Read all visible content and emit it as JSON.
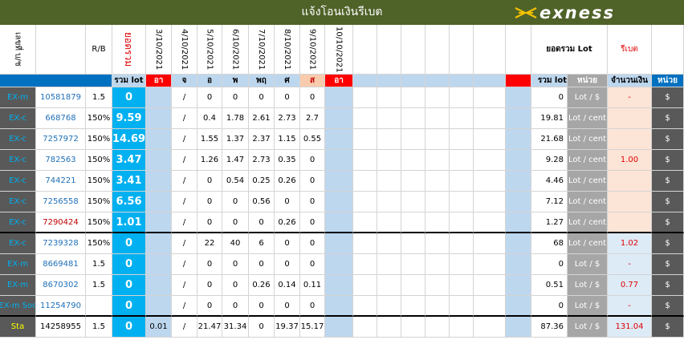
{
  "header": {
    "title": "แจ้งโอนเงินรีเบต",
    "brand": "exness"
  },
  "colors": {
    "title_bar": "#4f6228",
    "label_blue": "#0070c0",
    "cyan": "#00b0f0",
    "light_blue": "#bdd7ee",
    "pale_blue": "#ddebf7",
    "gray": "#a6a6a6",
    "dark_gray": "#595959",
    "red": "#ff0000",
    "peach": "#fce4d6",
    "olive_label": "#ffff00"
  },
  "top_headers": {
    "account": "เลขที่ บ/ช",
    "rb": "R/B",
    "total_rebate": "ยอดรวม",
    "dates": [
      "3/10/2021",
      "4/10/2021",
      "5/10/2021",
      "6/10/2021",
      "7/10/2021",
      "8/10/2021",
      "9/10/2021",
      "10/10/2021"
    ],
    "sum_lot": "ยอดรวม Lot",
    "rebate": "รีเบต"
  },
  "sub_headers": {
    "sum_lot": "รวม lot",
    "days": [
      "อา",
      "จ",
      "อ",
      "พ",
      "พฤ",
      "ศ",
      "ส",
      "อา"
    ],
    "sum_lot2": "รวม lot",
    "unit": "หน่วย",
    "amount": "จำนวนเงิน",
    "unit2": "หน่วย"
  },
  "rows": [
    {
      "type": "EX-m",
      "acc": "10581879",
      "rb": "1.5",
      "total": "0",
      "d": [
        "",
        "/",
        "0",
        "0",
        "0",
        "0",
        "0",
        ""
      ],
      "sum": "0",
      "unit": "Lot / $",
      "amount": "-",
      "cur": "$",
      "acc_color": "blue"
    },
    {
      "type": "EX-c",
      "acc": "668768",
      "rb": "150%",
      "total": "9.59",
      "d": [
        "",
        "/",
        "0.4",
        "1.78",
        "2.61",
        "2.73",
        "2.7",
        ""
      ],
      "sum": "19.81",
      "unit": "Lot / cent",
      "amount": "",
      "cur": "$",
      "acc_color": "blue"
    },
    {
      "type": "EX-c",
      "acc": "7257972",
      "rb": "150%",
      "total": "14.69",
      "d": [
        "",
        "/",
        "1.55",
        "1.37",
        "2.37",
        "1.15",
        "0.55",
        ""
      ],
      "sum": "21.68",
      "unit": "Lot / cent",
      "amount": "",
      "cur": "$",
      "acc_color": "blue"
    },
    {
      "type": "EX-c",
      "acc": "782563",
      "rb": "150%",
      "total": "3.47",
      "d": [
        "",
        "/",
        "1.26",
        "1.47",
        "2.73",
        "0.35",
        "0",
        ""
      ],
      "sum": "9.28",
      "unit": "Lot / cent",
      "amount": "1.00",
      "cur": "$",
      "acc_color": "blue"
    },
    {
      "type": "EX-c",
      "acc": "744221",
      "rb": "150%",
      "total": "3.41",
      "d": [
        "",
        "/",
        "0",
        "0.54",
        "0.25",
        "0.26",
        "0",
        ""
      ],
      "sum": "4.46",
      "unit": "Lot / cent",
      "amount": "",
      "cur": "$",
      "acc_color": "blue"
    },
    {
      "type": "EX-c",
      "acc": "7256558",
      "rb": "150%",
      "total": "6.56",
      "d": [
        "",
        "/",
        "0",
        "0",
        "0.56",
        "0",
        "0",
        ""
      ],
      "sum": "7.12",
      "unit": "Lot / cent",
      "amount": "",
      "cur": "$",
      "acc_color": "blue"
    },
    {
      "type": "EX-c",
      "acc": "7290424",
      "rb": "150%",
      "total": "1.01",
      "d": [
        "",
        "/",
        "0",
        "0",
        "0",
        "0.26",
        "0",
        ""
      ],
      "sum": "1.27",
      "unit": "Lot / cent",
      "amount": "",
      "cur": "$",
      "acc_color": "red"
    },
    {
      "type": "EX-c",
      "acc": "7239328",
      "rb": "150%",
      "total": "0",
      "d": [
        "",
        "/",
        "22",
        "40",
        "6",
        "0",
        "0",
        ""
      ],
      "sum": "68",
      "unit": "Lot / cent",
      "amount": "1.02",
      "cur": "$",
      "acc_color": "blue"
    },
    {
      "type": "EX-m",
      "acc": "8669481",
      "rb": "1.5",
      "total": "0",
      "d": [
        "",
        "/",
        "0",
        "0",
        "0",
        "0",
        "0",
        ""
      ],
      "sum": "0",
      "unit": "Lot / $",
      "amount": "-",
      "cur": "$",
      "acc_color": "blue"
    },
    {
      "type": "EX-m",
      "acc": "8670302",
      "rb": "1.5",
      "total": "0",
      "d": [
        "",
        "/",
        "0",
        "0",
        "0.26",
        "0.14",
        "0.11",
        ""
      ],
      "sum": "0.51",
      "unit": "Lot / $",
      "amount": "0.77",
      "cur": "$",
      "acc_color": "blue"
    },
    {
      "type": "EX-m Soc",
      "acc": "11254790",
      "rb": "",
      "total": "0",
      "d": [
        "",
        "/",
        "0",
        "0",
        "0",
        "0",
        "0",
        ""
      ],
      "sum": "0",
      "unit": "Lot / $",
      "amount": "-",
      "cur": "$",
      "acc_color": "blue"
    },
    {
      "type": "Sta",
      "acc": "14258955",
      "rb": "1.5",
      "total": "0",
      "d": [
        "0.01",
        "/",
        "21.47",
        "31.34",
        "0",
        "19.37",
        "15.17",
        ""
      ],
      "sum": "87.36",
      "unit": "Lot / $",
      "amount": "131.04",
      "cur": "$",
      "acc_color": "black"
    }
  ]
}
